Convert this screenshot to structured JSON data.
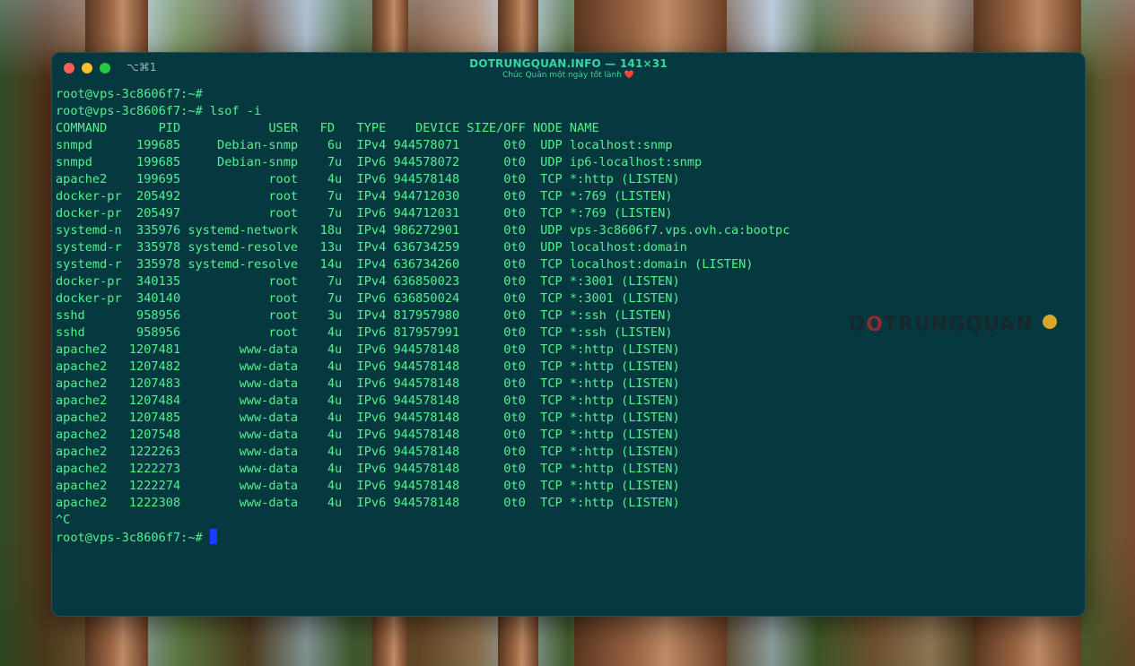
{
  "window": {
    "shortcut": "⌥⌘1",
    "title": "DOTRUNGQUAN.INFO — 141×31",
    "subtitle": "Chúc Quân một ngày tốt lành",
    "subtitle_icon": "red-heart-emoji"
  },
  "terminal": {
    "lines": [
      "root@vps-3c8606f7:~#",
      "root@vps-3c8606f7:~# lsof -i",
      "COMMAND       PID            USER   FD   TYPE    DEVICE SIZE/OFF NODE NAME",
      "snmpd      199685     Debian-snmp    6u  IPv4 944578071      0t0  UDP localhost:snmp",
      "snmpd      199685     Debian-snmp    7u  IPv6 944578072      0t0  UDP ip6-localhost:snmp",
      "apache2    199695            root    4u  IPv6 944578148      0t0  TCP *:http (LISTEN)",
      "docker-pr  205492            root    7u  IPv4 944712030      0t0  TCP *:769 (LISTEN)",
      "docker-pr  205497            root    7u  IPv6 944712031      0t0  TCP *:769 (LISTEN)",
      "systemd-n  335976 systemd-network   18u  IPv4 986272901      0t0  UDP vps-3c8606f7.vps.ovh.ca:bootpc",
      "systemd-r  335978 systemd-resolve   13u  IPv4 636734259      0t0  UDP localhost:domain",
      "systemd-r  335978 systemd-resolve   14u  IPv4 636734260      0t0  TCP localhost:domain (LISTEN)",
      "docker-pr  340135            root    7u  IPv4 636850023      0t0  TCP *:3001 (LISTEN)",
      "docker-pr  340140            root    7u  IPv6 636850024      0t0  TCP *:3001 (LISTEN)",
      "sshd       958956            root    3u  IPv4 817957980      0t0  TCP *:ssh (LISTEN)",
      "sshd       958956            root    4u  IPv6 817957991      0t0  TCP *:ssh (LISTEN)",
      "apache2   1207481        www-data    4u  IPv6 944578148      0t0  TCP *:http (LISTEN)",
      "apache2   1207482        www-data    4u  IPv6 944578148      0t0  TCP *:http (LISTEN)",
      "apache2   1207483        www-data    4u  IPv6 944578148      0t0  TCP *:http (LISTEN)",
      "apache2   1207484        www-data    4u  IPv6 944578148      0t0  TCP *:http (LISTEN)",
      "apache2   1207485        www-data    4u  IPv6 944578148      0t0  TCP *:http (LISTEN)",
      "apache2   1207548        www-data    4u  IPv6 944578148      0t0  TCP *:http (LISTEN)",
      "apache2   1222263        www-data    4u  IPv6 944578148      0t0  TCP *:http (LISTEN)",
      "apache2   1222273        www-data    4u  IPv6 944578148      0t0  TCP *:http (LISTEN)",
      "apache2   1222274        www-data    4u  IPv6 944578148      0t0  TCP *:http (LISTEN)",
      "apache2   1222308        www-data    4u  IPv6 944578148      0t0  TCP *:http (LISTEN)",
      "^C"
    ],
    "prompt": "root@vps-3c8606f7:~# "
  },
  "watermark": {
    "text_before": "D",
    "text_o": "O",
    "text_after": "TRUNGQUAN"
  },
  "colors": {
    "terminal_bg": "#05383f",
    "text": "#52f28e",
    "title": "#37d6a3",
    "cursor": "#1a3cff"
  }
}
